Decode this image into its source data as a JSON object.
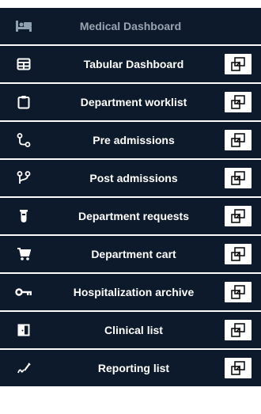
{
  "header": {
    "icon": "bed-icon",
    "title": "Medical Dashboard"
  },
  "items": [
    {
      "icon": "table-icon",
      "label": "Tabular Dashboard"
    },
    {
      "icon": "clipboard-icon",
      "label": "Department worklist"
    },
    {
      "icon": "route-icon",
      "label": "Pre admissions"
    },
    {
      "icon": "branch-icon",
      "label": "Post admissions"
    },
    {
      "icon": "test-tube-icon",
      "label": "Department requests"
    },
    {
      "icon": "cart-icon",
      "label": "Department cart"
    },
    {
      "icon": "key-icon",
      "label": "Hospitalization archive"
    },
    {
      "icon": "door-icon",
      "label": "Clinical list"
    },
    {
      "icon": "signature-icon",
      "label": "Reporting list"
    }
  ],
  "action_icon": "open-in-new-window-icon",
  "colors": {
    "row_bg": "#0d1a2c",
    "text": "#ffffff",
    "header_text": "#9aa3b0",
    "button_bg": "#ffffff"
  }
}
